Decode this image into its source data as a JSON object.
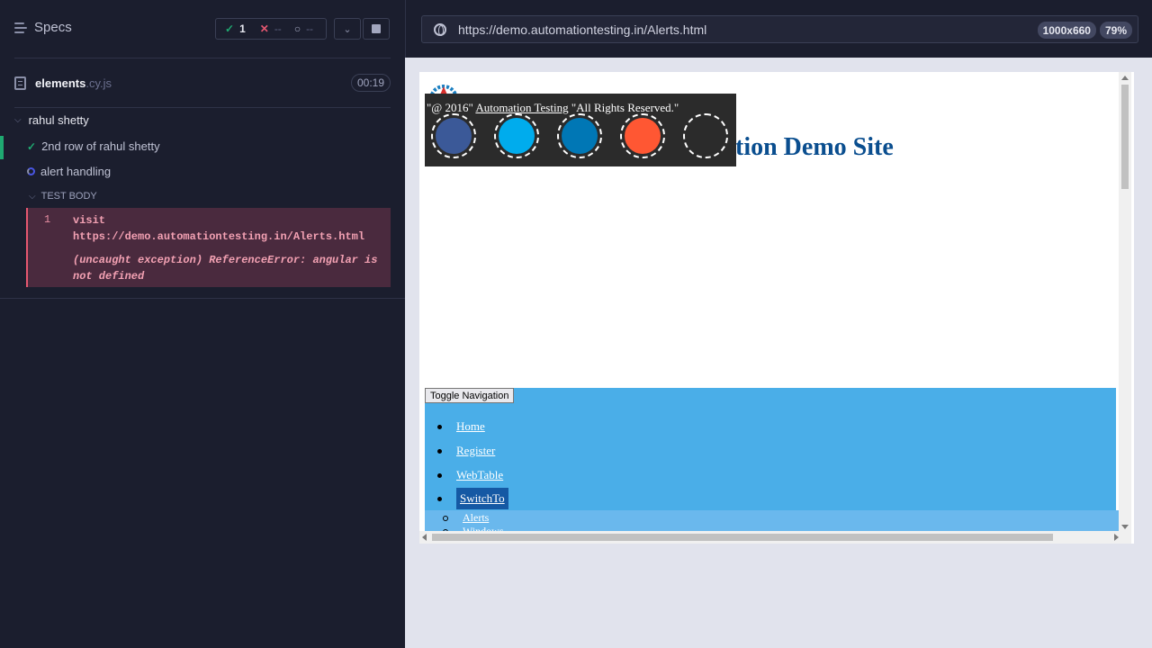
{
  "reporter": {
    "specs_label": "Specs",
    "stats": {
      "passed": "1",
      "failed": "--",
      "pending": "--"
    },
    "file": {
      "name": "elements",
      "ext": ".cy.js",
      "duration": "00:19"
    },
    "suite": {
      "title": "rahul shetty"
    },
    "tests": [
      {
        "title": "2nd row of rahul shetty",
        "state": "passed"
      },
      {
        "title": "alert handling",
        "state": "running"
      }
    ],
    "test_body_label": "TEST BODY",
    "command": {
      "number": "1",
      "text": "visit  https://demo.automationtesting.in/Alerts.html",
      "error": "(uncaught exception)  ReferenceError: angular is not defined"
    }
  },
  "aut": {
    "url": "https://demo.automationtesting.in/Alerts.html",
    "viewport": "1000x660",
    "zoom": "79%"
  },
  "site": {
    "title": "tion Demo Site",
    "social_text_prefix": "\"@ 2016\" ",
    "social_text_link": "Automation Testing",
    "social_text_suffix": " \"All Rights Reserved.\"",
    "social_colors": [
      "#3b5998",
      "#00aced",
      "#0077b5",
      "#ff5733",
      "#2b2b2b"
    ],
    "toggle_label": "Toggle Navigation",
    "nav": [
      "Home",
      "Register",
      "WebTable",
      "SwitchTo"
    ],
    "subnav": [
      "Alerts",
      "Windows"
    ]
  },
  "colors": {
    "pass": "#1fa971",
    "fail": "#e45770",
    "nav_bg": "#4aaee8",
    "title": "#0a4e8f"
  }
}
